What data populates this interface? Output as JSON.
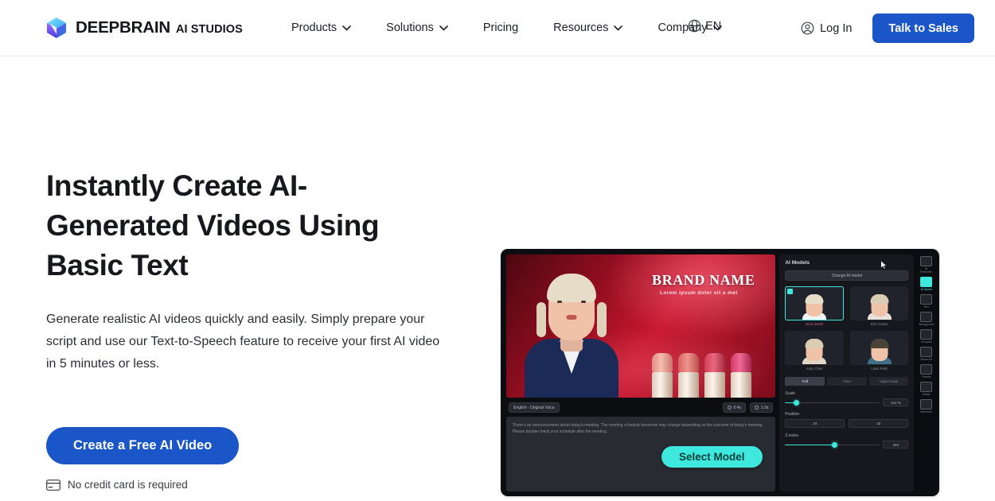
{
  "nav": {
    "brand": {
      "name": "DEEPBRAIN",
      "sub": "AI STUDIOS",
      "icon": "cube-logo-icon"
    },
    "links": [
      {
        "label": "Products",
        "caret": true
      },
      {
        "label": "Solutions",
        "caret": true
      },
      {
        "label": "Pricing",
        "caret": false
      },
      {
        "label": "Resources",
        "caret": true
      },
      {
        "label": "Company",
        "caret": true
      }
    ],
    "language": {
      "label": "EN",
      "icon": "globe-icon"
    },
    "login": {
      "label": "Log In",
      "icon": "user-circle-icon"
    },
    "cta": {
      "label": "Talk to Sales"
    }
  },
  "hero": {
    "heading": "Instantly Create AI-Generated Videos Using Basic Text",
    "paragraph": "Generate realistic AI videos quickly and easily. Simply prepare your script and use our Text-to-Speech feature to receive your first AI video in 5 minutes or less.",
    "cta_label": "Create a Free AI Video",
    "note": "No credit card is required",
    "note_icon": "credit-card-icon"
  },
  "app": {
    "stage": {
      "brand_name": "BRAND NAME",
      "brand_tagline": "Lorem ipsum dolor sit a met"
    },
    "transport": {
      "voice_chip": "English - Original Voice",
      "duration_chips": [
        "0.4s",
        "1.0s"
      ]
    },
    "script_text": "There's an announcement about today's meeting. The meeting schedule tomorrow may change depending on the outcome of today's meeting. Please double-check your schedule after the meeting.",
    "select_model_button": "Select Model",
    "panel": {
      "title": "AI Models",
      "change_button": "Change AI model",
      "models": [
        {
          "name": "Nina Smith",
          "hair": "#e7dcc8",
          "body": "#f2f3f5",
          "selected": true
        },
        {
          "name": "Erin Carter",
          "hair": "#d9cdb6",
          "body": "#e7e3db",
          "selected": false
        },
        {
          "name": "Amy Chen",
          "hair": "#dacdb2",
          "body": "#dfd6c8",
          "selected": false
        },
        {
          "name": "Liam Park",
          "hair": "#4a4338",
          "body": "#3f6f86",
          "selected": false
        }
      ],
      "segments": [
        {
          "label": "Full",
          "active": true
        },
        {
          "label": "Face",
          "active": false
        },
        {
          "label": "Upper body",
          "active": false
        }
      ],
      "scale": {
        "label": "Scale",
        "value": "101 %",
        "percent": 12
      },
      "position": {
        "label": "Position",
        "x": "24",
        "y": "42"
      },
      "zindex": {
        "label": "Z-index",
        "value": "404",
        "percent": 52
      }
    },
    "tools": [
      {
        "label": "AI Presenter",
        "icon": "presenter-icon",
        "active": false
      },
      {
        "label": "AI Model",
        "icon": "ai-model-icon",
        "active": true
      },
      {
        "label": "Text",
        "icon": "text-icon",
        "active": false
      },
      {
        "label": "Background",
        "icon": "background-icon",
        "active": false
      },
      {
        "label": "Template",
        "icon": "template-icon",
        "active": false
      },
      {
        "label": "Brand Kit",
        "icon": "brandkit-icon",
        "active": false
      },
      {
        "label": "Frames",
        "icon": "frames-icon",
        "active": false
      },
      {
        "label": "Media",
        "icon": "media-icon",
        "active": false
      },
      {
        "label": "Elements",
        "icon": "elements-icon",
        "active": false
      }
    ]
  },
  "colors": {
    "brand_blue": "#1a56c8",
    "accent_cyan": "#3ee8dc",
    "app_dark": "#0c0d11"
  }
}
